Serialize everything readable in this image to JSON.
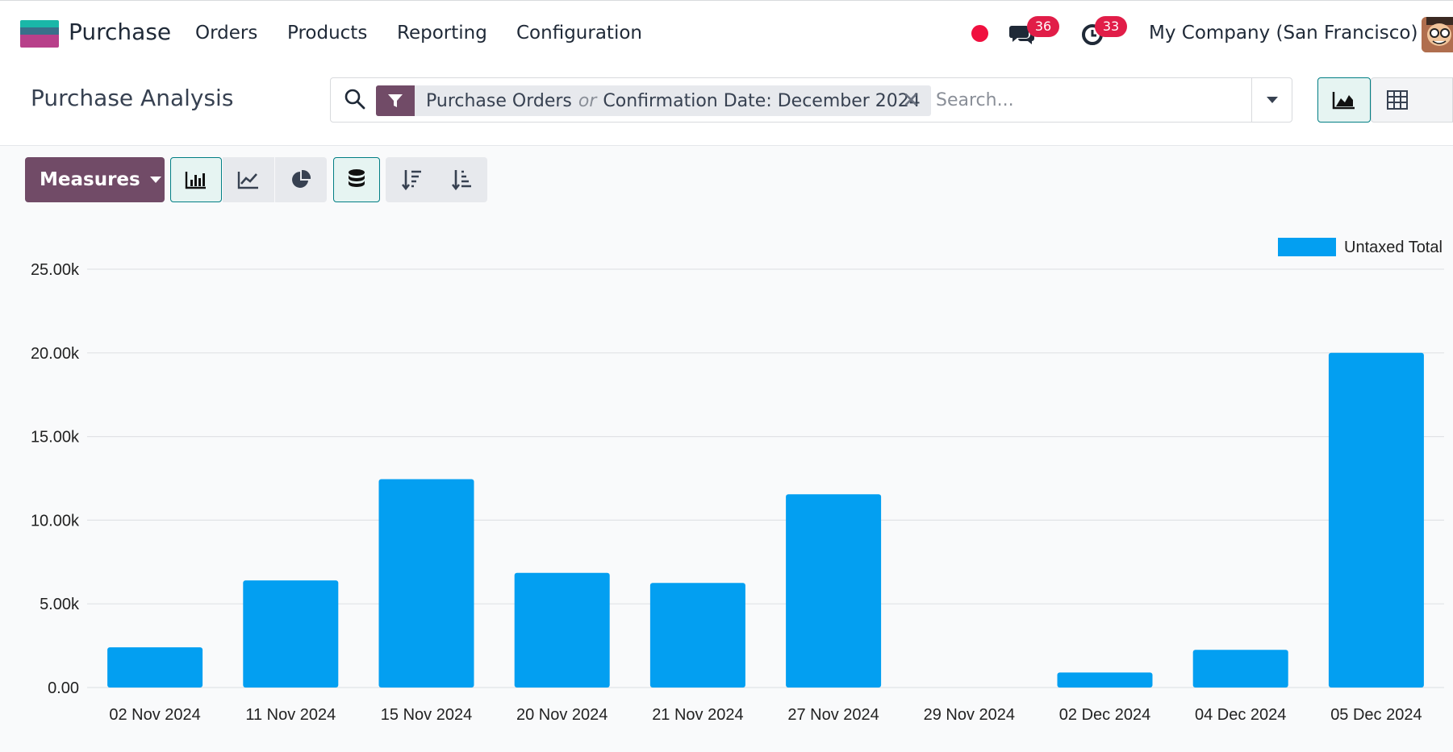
{
  "nav": {
    "app_name": "Purchase",
    "menu": [
      "Orders",
      "Products",
      "Reporting",
      "Configuration"
    ],
    "messages_count": "36",
    "activities_count": "33",
    "company": "My Company (San Francisco)"
  },
  "control": {
    "title": "Purchase Analysis",
    "facet": {
      "part1": "Purchase Orders",
      "separator": "or",
      "part2": "Confirmation Date: December 2024"
    },
    "search_placeholder": "Search..."
  },
  "toolbar": {
    "measures_label": "Measures"
  },
  "colors": {
    "brand": "#714b67",
    "bar": "#039ff1",
    "badge": "#e11d48",
    "active_teal": "#017e84"
  },
  "icons": {
    "nav": [
      "recording-dot-icon",
      "chat-icon",
      "clock-icon"
    ],
    "search": [
      "search-icon",
      "filter-icon",
      "close-icon",
      "caret-down-icon"
    ],
    "views": [
      "area-chart-icon",
      "table-icon"
    ],
    "toolbar": [
      "bar-chart-icon",
      "line-chart-icon",
      "pie-chart-icon",
      "database-icon",
      "sort-descending-icon",
      "sort-ascending-icon"
    ]
  },
  "chart_data": {
    "type": "bar",
    "categories": [
      "02 Nov 2024",
      "11 Nov 2024",
      "15 Nov 2024",
      "20 Nov 2024",
      "21 Nov 2024",
      "27 Nov 2024",
      "29 Nov 2024",
      "02 Dec 2024",
      "04 Dec 2024",
      "05 Dec 2024"
    ],
    "series": [
      {
        "name": "Untaxed Total",
        "values": [
          2400,
          6400,
          12450,
          6850,
          6250,
          11550,
          0,
          900,
          2250,
          20000
        ]
      }
    ],
    "yticks": [
      "0.00",
      "5.00k",
      "10.00k",
      "15.00k",
      "20.00k",
      "25.00k"
    ],
    "ylim": [
      0,
      25000
    ],
    "grid": true,
    "legend": "top-right"
  }
}
